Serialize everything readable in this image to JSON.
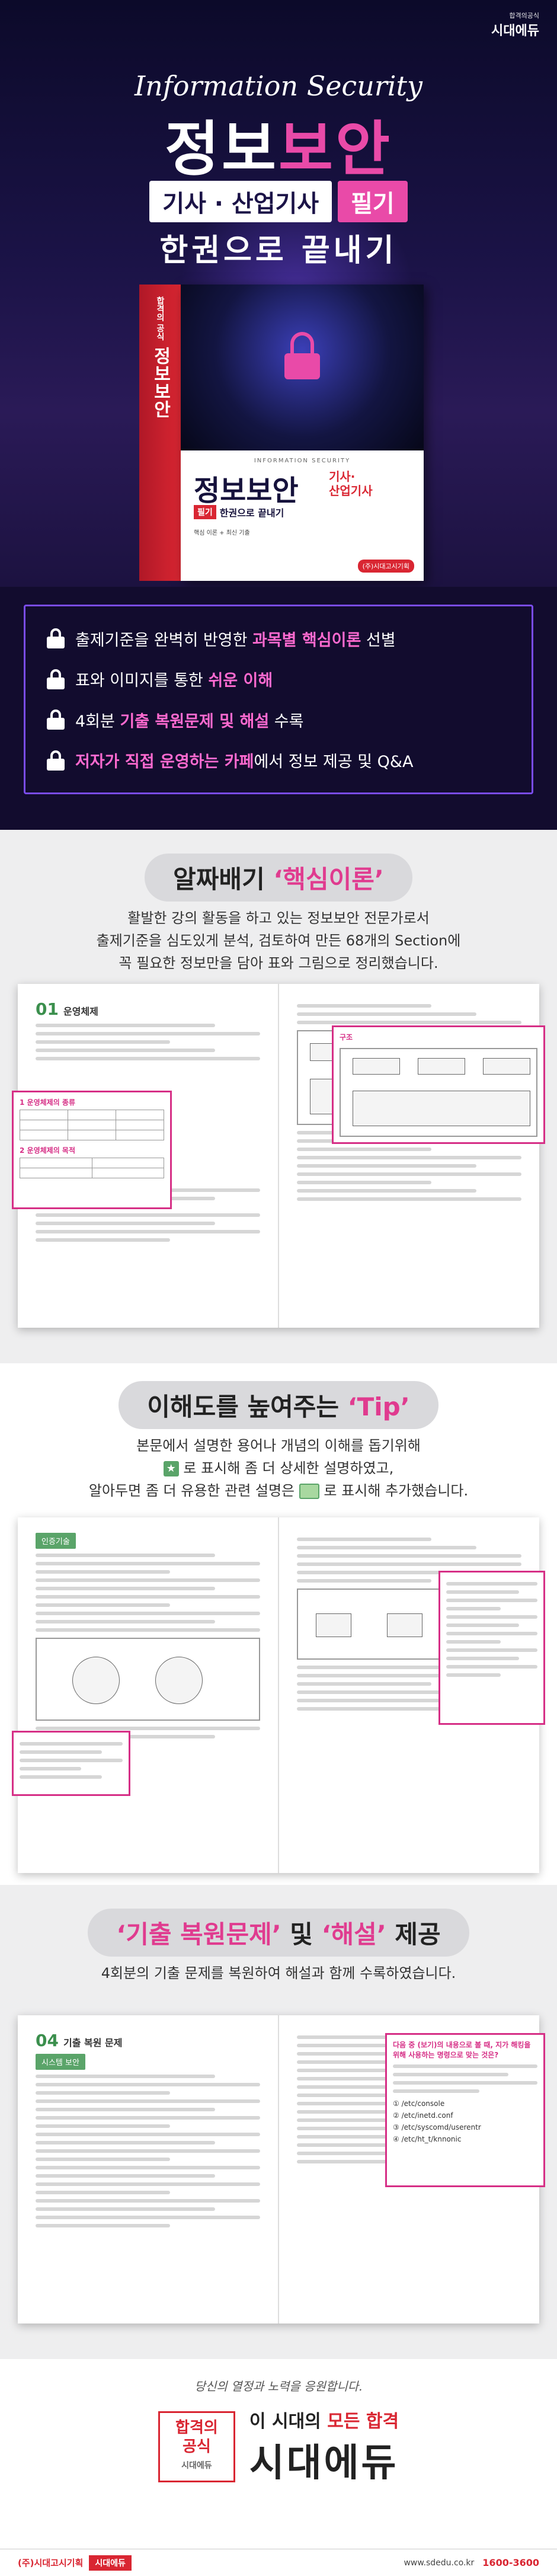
{
  "brand": {
    "top_small": "합격의공식",
    "top_big": "시대에듀"
  },
  "hero": {
    "english_title": "Information Security",
    "title_part1": "정보",
    "title_part2": "보안",
    "cert": "기사 · 산업기사",
    "cert_tag": "필기",
    "slogan": "한권으로 끝내기"
  },
  "book": {
    "spine_top": "합격의 공식",
    "spine_title": "정보보안",
    "cover_en": "INFORMATION SECURITY",
    "cover_title": "정보보안",
    "cover_cert_1": "기사·",
    "cover_cert_2": "산업기사",
    "cover_tag": "필기",
    "cover_sub": "한권으로 끝내기",
    "cover_points": "핵심 이론 + 최신 기출",
    "publisher": "(주)시대고시기획"
  },
  "features": [
    {
      "pre": "출제기준을 완벽히 반영한 ",
      "hl": "과목별 핵심이론",
      "post": " 선별"
    },
    {
      "pre": "표와 이미지를 통한 ",
      "hl": "쉬운 이해",
      "post": ""
    },
    {
      "pre": "4회분 ",
      "hl": "기출 복원문제 및 해설",
      "post": " 수록"
    },
    {
      "pre": "",
      "hl": "저자가 직접 운영하는 카페",
      "post": "에서 정보 제공 및 Q&A"
    }
  ],
  "section1": {
    "title_pre": "알짜배기 ",
    "title_hl": "‘핵심이론’",
    "desc_1": "활발한 강의 활동을 하고 있는 정보보안 전문가로서",
    "desc_2": "출제기준을 심도있게 분석, 검토하여 만든 68개의 Section에",
    "desc_3": "꼭 필요한 정보만을 담아 표와 그림으로 정리했습니다.",
    "page_num": "01",
    "page_head": "운영체제",
    "callout_title": "1 운영체제의 종류",
    "callout_title2": "2 운영체제의 목적",
    "diagram_label": "구조"
  },
  "section2": {
    "title_pre": "이해도를 높여주는 ",
    "title_hl": "‘Tip’",
    "desc_1": "본문에서 설명한 용어나 개념의 이해를 돕기위해",
    "desc_2a": "",
    "desc_2b": " 로 표시해 좀 더 상세한 설명하였고,",
    "desc_3a": "알아두면 좀 더 유용한 관련 설명은",
    "desc_3b": "로 표시해 추가했습니다.",
    "chip": "인증기술"
  },
  "section3": {
    "title_hl1": "‘기출 복원문제’",
    "title_mid": " 및 ",
    "title_hl2": "‘해설’",
    "title_post": " 제공",
    "desc": "4회분의 기출 문제를 복원하여 해설과 함께 수록하였습니다.",
    "page_num": "04",
    "page_head": "기출 복원 문제",
    "chip": "시스템 보안",
    "quiz_q": "다음 중 (보기)의 내용으로 볼 때, 지가 해킹을 위해 사용하는 명령으로 맞는 것은?",
    "opt1": "① /etc/console",
    "opt2": "② /etc/inetd.conf",
    "opt3": "③ /etc/syscomd/userentr",
    "opt4": "④ /etc/ht_t/knnonic"
  },
  "footer": {
    "script": "당신의 열정과 노력을 응원합니다.",
    "logo_1": "합격의",
    "logo_2": "공식",
    "logo_3": "시대에듀",
    "tag_1": "이 시대의 ",
    "tag_2": "모든 합격",
    "name": "시대에듀",
    "publisher": "(주)시대고시기획",
    "brand": "시대에듀",
    "url": "www.sdedu.co.kr",
    "tel": "1600-3600"
  }
}
